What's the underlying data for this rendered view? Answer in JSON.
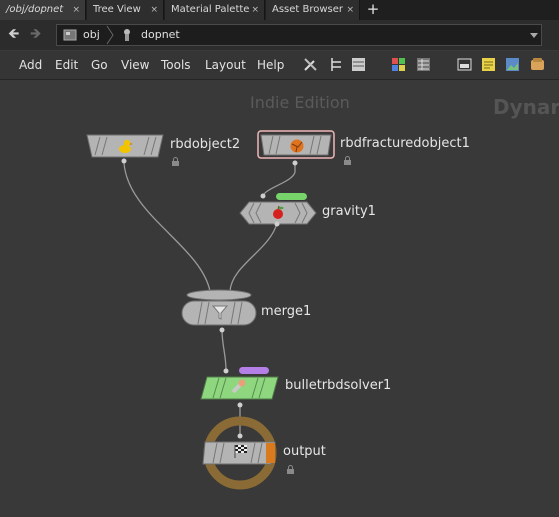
{
  "tabs": [
    {
      "label": "/obj/dopnet",
      "close": "×",
      "active": true
    },
    {
      "label": "Tree View",
      "close": "×",
      "active": false
    },
    {
      "label": "Material Palette",
      "close": "×",
      "active": false
    },
    {
      "label": "Asset Browser",
      "close": "×",
      "active": false
    }
  ],
  "tab_add": "+",
  "path": {
    "crumbs": [
      "obj",
      "dopnet"
    ]
  },
  "menu": [
    "Add",
    "Edit",
    "Go",
    "View",
    "Tools",
    "Layout",
    "Help"
  ],
  "network": {
    "watermark": "Indie Edition",
    "title": "Dynar",
    "nodes": {
      "rbdobject2": "rbdobject2",
      "rbdfracturedobject1": "rbdfracturedobject1",
      "gravity1": "gravity1",
      "merge1": "merge1",
      "bulletrbdsolver1": "bulletrbdsolver1",
      "output": "output"
    }
  },
  "colors": {
    "node_grey": "#b4b4b4",
    "solver_green": "#8ed77f",
    "flag_green": "#77d46a",
    "flag_purple": "#b47fe6",
    "output_ring": "#8a6a35",
    "output_flag": "#d97a1f",
    "selected_outline": "#f2b8b8"
  }
}
